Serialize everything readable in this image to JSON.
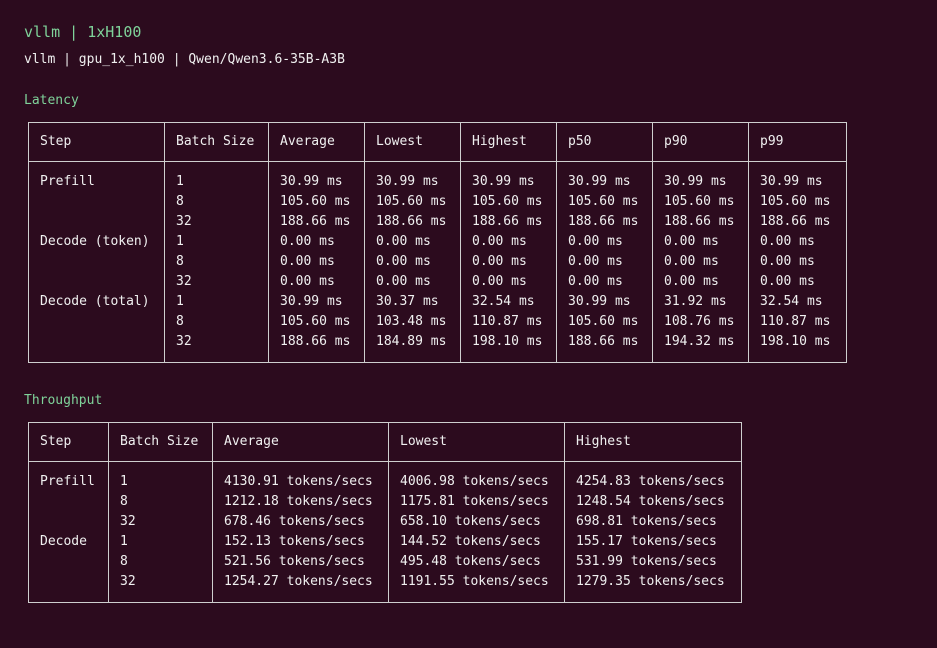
{
  "header": {
    "title": "vllm | 1xH100",
    "subtitle": "vllm | gpu_1x_h100 | Qwen/Qwen3.6-35B-A3B"
  },
  "latency": {
    "label": "Latency",
    "columns": [
      "Step",
      "Batch Size",
      "Average",
      "Lowest",
      "Highest",
      "p50",
      "p90",
      "p99"
    ],
    "rows": [
      [
        "Prefill",
        "1",
        "30.99 ms",
        "30.99 ms",
        "30.99 ms",
        "30.99 ms",
        "30.99 ms",
        "30.99 ms"
      ],
      [
        "",
        "8",
        "105.60 ms",
        "105.60 ms",
        "105.60 ms",
        "105.60 ms",
        "105.60 ms",
        "105.60 ms"
      ],
      [
        "",
        "32",
        "188.66 ms",
        "188.66 ms",
        "188.66 ms",
        "188.66 ms",
        "188.66 ms",
        "188.66 ms"
      ],
      [
        "Decode (token)",
        "1",
        "0.00 ms",
        "0.00 ms",
        "0.00 ms",
        "0.00 ms",
        "0.00 ms",
        "0.00 ms"
      ],
      [
        "",
        "8",
        "0.00 ms",
        "0.00 ms",
        "0.00 ms",
        "0.00 ms",
        "0.00 ms",
        "0.00 ms"
      ],
      [
        "",
        "32",
        "0.00 ms",
        "0.00 ms",
        "0.00 ms",
        "0.00 ms",
        "0.00 ms",
        "0.00 ms"
      ],
      [
        "Decode (total)",
        "1",
        "30.99 ms",
        "30.37 ms",
        "32.54 ms",
        "30.99 ms",
        "31.92 ms",
        "32.54 ms"
      ],
      [
        "",
        "8",
        "105.60 ms",
        "103.48 ms",
        "110.87 ms",
        "105.60 ms",
        "108.76 ms",
        "110.87 ms"
      ],
      [
        "",
        "32",
        "188.66 ms",
        "184.89 ms",
        "198.10 ms",
        "188.66 ms",
        "194.32 ms",
        "198.10 ms"
      ]
    ]
  },
  "throughput": {
    "label": "Throughput",
    "columns": [
      "Step",
      "Batch Size",
      "Average",
      "Lowest",
      "Highest"
    ],
    "rows": [
      [
        "Prefill",
        "1",
        "4130.91 tokens/secs",
        "4006.98 tokens/secs",
        "4254.83 tokens/secs"
      ],
      [
        "",
        "8",
        "1212.18 tokens/secs",
        "1175.81 tokens/secs",
        "1248.54 tokens/secs"
      ],
      [
        "",
        "32",
        "678.46 tokens/secs",
        "658.10 tokens/secs",
        "698.81 tokens/secs"
      ],
      [
        "Decode",
        "1",
        "152.13 tokens/secs",
        "144.52 tokens/secs",
        "155.17 tokens/secs"
      ],
      [
        "",
        "8",
        "521.56 tokens/secs",
        "495.48 tokens/secs",
        "531.99 tokens/secs"
      ],
      [
        "",
        "32",
        "1254.27 tokens/secs",
        "1191.55 tokens/secs",
        "1279.35 tokens/secs"
      ]
    ]
  }
}
